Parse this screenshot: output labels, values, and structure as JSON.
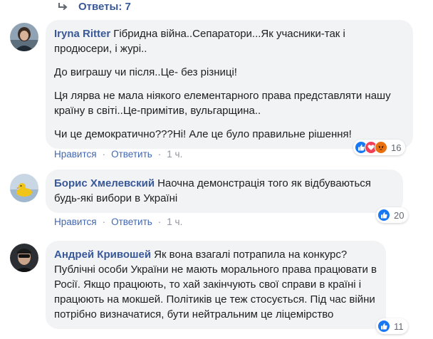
{
  "replies": {
    "label": "Ответы: 7"
  },
  "colors": {
    "link": "#385898",
    "like": "#1877f2",
    "love": "#f33e58",
    "angry": "#e9710f",
    "bubble": "#f2f3f5"
  },
  "comments": [
    {
      "author": "Iryna Ritter",
      "paragraphs": [
        "Гібридна війна..Сепаратори...Як учасники-так і продюсери, і журі..",
        "До виграшу чи після..Це- без різниці!",
        "Ця лярва не мала ніякого елементарного права представляти нашу країну в світі..Це-примітив, вульгарщина..",
        "Чи це демократично???Ні! Але це було правильне рішення!"
      ],
      "like_label": "Нравится",
      "reply_label": "Ответить",
      "time": "1 ч.",
      "reaction_icons": [
        "like-icon",
        "love-icon",
        "angry-icon"
      ],
      "reaction_count": "16"
    },
    {
      "author": "Борис Хмелевский",
      "paragraphs": [
        "Наочна демонстрація того як відбуваються будь-які вибори в Україні"
      ],
      "like_label": "Нравится",
      "reply_label": "Ответить",
      "time": "1 ч.",
      "reaction_icons": [
        "like-icon"
      ],
      "reaction_count": "20"
    },
    {
      "author": "Андрей Кривошей",
      "paragraphs": [
        "Як вона взагалі потрапила на конкурс? Публічні особи України не мають морального права працювати в Росії. Якщо працюють, то хай закінчують свої справи в країні і працюють на мокшей. Політиків це теж стосується. Під час війни потрібно визначатися, бути нейтральним це ліцемірство"
      ],
      "reaction_icons": [
        "like-icon"
      ],
      "reaction_count": "11"
    }
  ]
}
